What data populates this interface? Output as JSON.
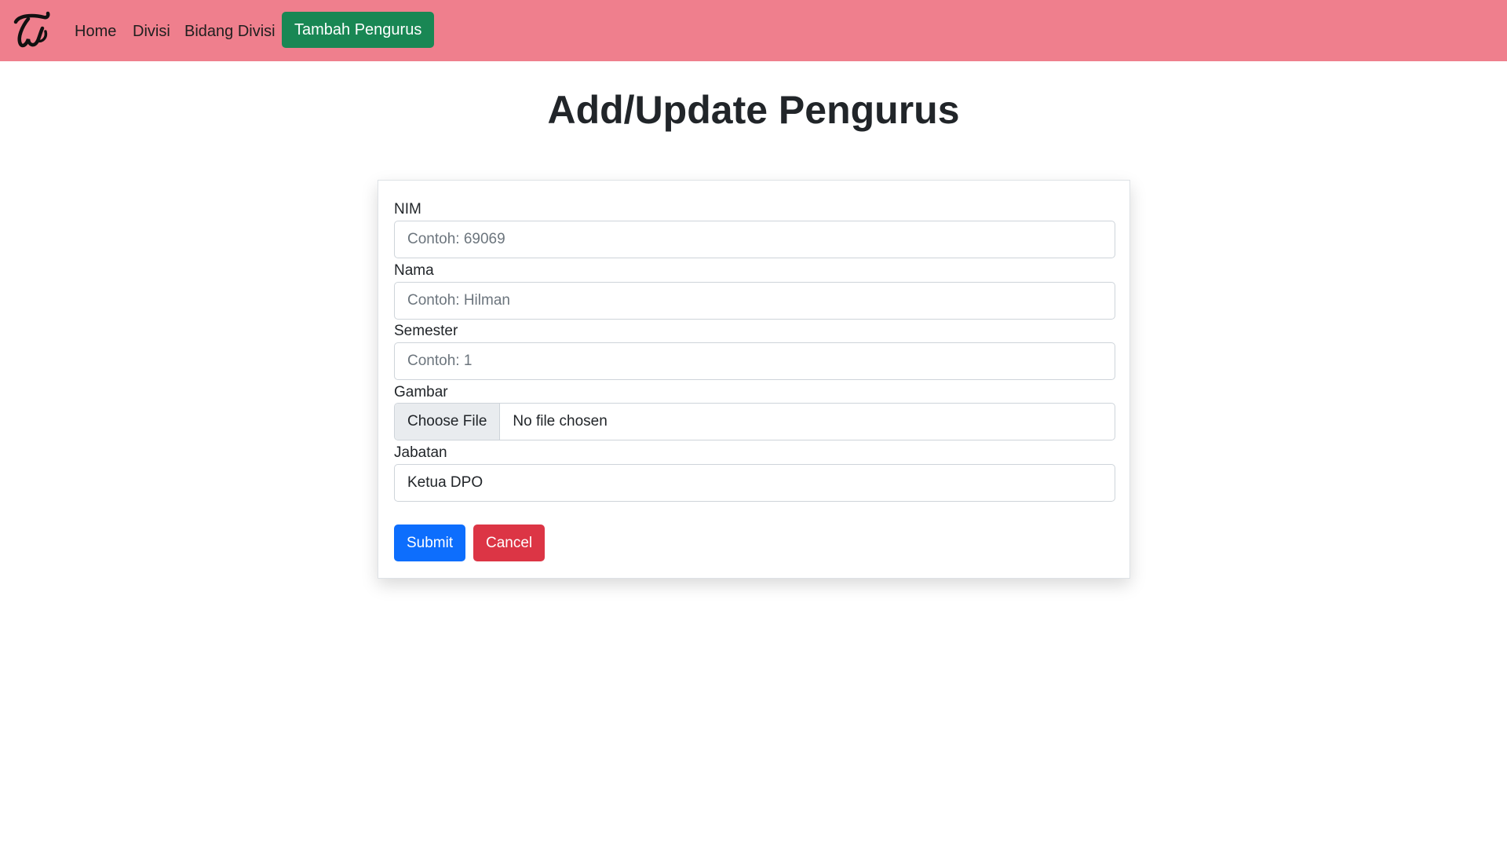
{
  "nav": {
    "brand_icon": "twice-logo-icon",
    "home": "Home",
    "divisi": "Divisi",
    "bidang_divisi": "Bidang Divisi",
    "tambah_pengurus": "Tambah Pengurus"
  },
  "page": {
    "title": "Add/Update Pengurus"
  },
  "form": {
    "nim": {
      "label": "NIM",
      "placeholder": "Contoh: 69069",
      "value": ""
    },
    "nama": {
      "label": "Nama",
      "placeholder": "Contoh: Hilman",
      "value": ""
    },
    "semester": {
      "label": "Semester",
      "placeholder": "Contoh: 1",
      "value": ""
    },
    "gambar": {
      "label": "Gambar",
      "button": "Choose File",
      "status": "No file chosen"
    },
    "jabatan": {
      "label": "Jabatan",
      "value": "Ketua DPO"
    },
    "submit": "Submit",
    "cancel": "Cancel"
  },
  "colors": {
    "navbar": "#ef7f8d",
    "tambah_button": "#198754",
    "submit_button": "#0d6efd",
    "cancel_button": "#dc3545"
  }
}
